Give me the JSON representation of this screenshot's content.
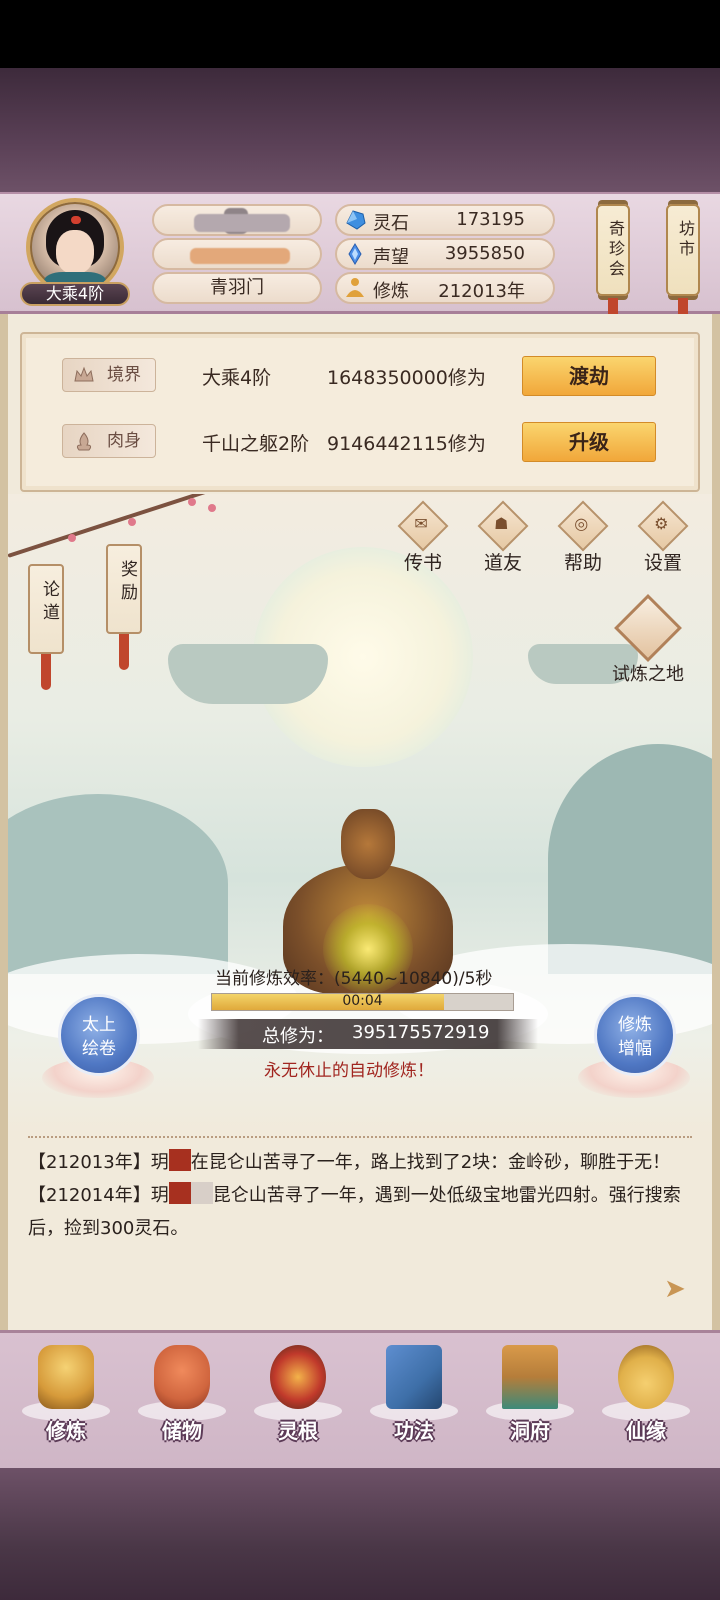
{
  "profile": {
    "rank": "大乘4阶",
    "name": "",
    "title": "",
    "sect": "青羽门"
  },
  "resources": [
    {
      "icon": "spirit-stone-icon",
      "label": "灵石",
      "value": "173195"
    },
    {
      "icon": "reputation-icon",
      "label": "声望",
      "value": "3955850"
    },
    {
      "icon": "meditation-icon",
      "label": "修炼",
      "value": "212013年"
    }
  ],
  "top_buttons": {
    "treasure_fair": "奇珍会",
    "market": "坊市"
  },
  "stats": {
    "realm": {
      "tag": "境界",
      "level": "大乘4阶",
      "xp": "1648350000修为",
      "button": "渡劫"
    },
    "body": {
      "tag": "肉身",
      "level": "千山之躯2阶",
      "xp": "9146442115修为",
      "button": "升级"
    }
  },
  "scene_buttons": {
    "letters": "传书",
    "friends": "道友",
    "help": "帮助",
    "settings": "设置",
    "trial": "试炼之地",
    "discuss": "论道",
    "reward": "奖励"
  },
  "cultivation": {
    "efficiency_label": "当前修炼效率：",
    "efficiency_value": "(5440~10840)/5秒",
    "timer": "00:04",
    "progress_fraction": 0.77,
    "total_label": "总修为：",
    "total_value": "395175572919",
    "auto_text": "永无休止的自动修炼！",
    "left_orb": "太上\n绘卷",
    "right_orb": "修炼\n增幅"
  },
  "log": [
    {
      "year": "【212013年】",
      "pre": "玥",
      "post": "在昆仑山苦寻了一年，路上找到了2块：金岭砂，聊胜于无！"
    },
    {
      "year": "【212014年】",
      "pre": "玥",
      "post": "昆仑山苦寻了一年，遇到一处低级宝地雷光四射。强行搜索后，捡到300灵石。"
    }
  ],
  "nav": [
    {
      "name": "修炼",
      "color": "#d69a3a"
    },
    {
      "name": "储物",
      "color": "#d0653e"
    },
    {
      "name": "灵根",
      "color": "#c0392b"
    },
    {
      "name": "功法",
      "color": "#3e6fa8"
    },
    {
      "name": "洞府",
      "color": "#b57d3a"
    },
    {
      "name": "仙缘",
      "color": "#e0b04a"
    }
  ]
}
